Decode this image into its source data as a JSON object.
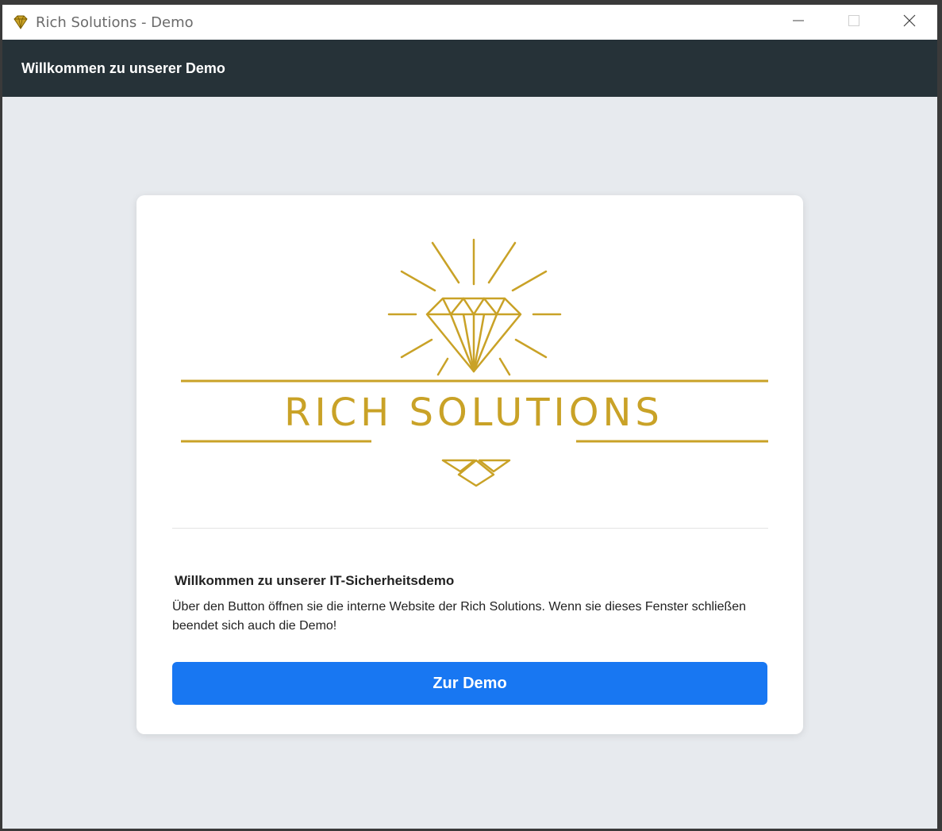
{
  "window": {
    "title": "Rich Solutions - Demo",
    "app_icon": "diamond-icon",
    "controls": [
      "minimize-icon",
      "maximize-icon",
      "close-icon"
    ]
  },
  "appbar": {
    "title": "Willkommen zu unserer Demo"
  },
  "card": {
    "logo_text": "RICH SOLUTIONS",
    "heading": "Willkommen zu unserer IT-Sicherheitsdemo",
    "description": "Über den Button öffnen sie die interne Website der Rich Solutions. Wenn sie dieses Fenster schließen beendet sich auch die Demo!",
    "button_label": "Zur Demo"
  },
  "colors": {
    "appbar_bg": "#263238",
    "window_bg": "#e7eaee",
    "accent_button": "#1877f2",
    "logo_gold": "#c9a227"
  }
}
